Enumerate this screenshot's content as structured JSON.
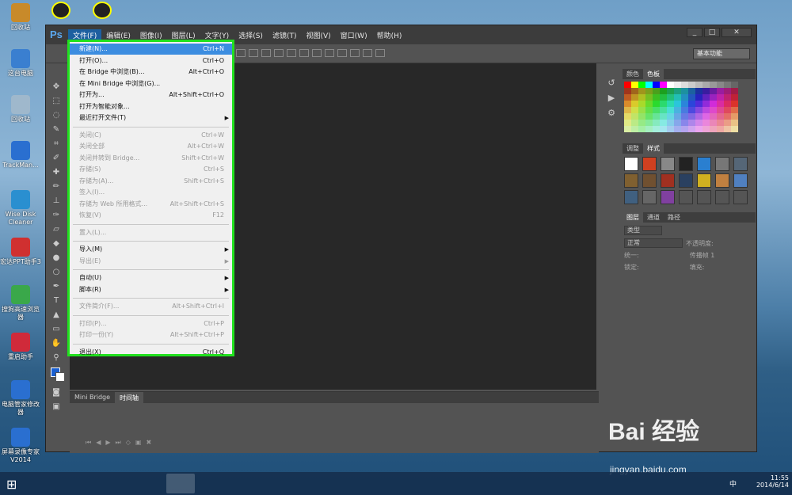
{
  "desktop_icons": [
    {
      "label": "回收站",
      "color": "#c88a2a"
    },
    {
      "label": "这台电脑",
      "color": "#3a7fd0"
    },
    {
      "label": "回收站",
      "color": "#9fb8cc"
    },
    {
      "label": "TrackMan...",
      "color": "#2a6fd0"
    },
    {
      "label": "Wise Disk Cleaner",
      "color": "#2a8fd0"
    },
    {
      "label": "宏达PPT助手3",
      "color": "#d03030"
    },
    {
      "label": "搜狗高速浏览器",
      "color": "#3aa84a"
    },
    {
      "label": "重启助手",
      "color": "#d02a3a"
    },
    {
      "label": "电脑管家修改器",
      "color": "#2a6fd0"
    },
    {
      "label": "屏幕录像专家V2014",
      "color": "#2a6fd0"
    }
  ],
  "top_icons": [
    {
      "label": ""
    },
    {
      "label": ""
    }
  ],
  "ps": {
    "logo": "Ps",
    "menus": [
      "文件(F)",
      "编辑(E)",
      "图像(I)",
      "图层(L)",
      "文字(Y)",
      "选择(S)",
      "滤镜(T)",
      "视图(V)",
      "窗口(W)",
      "帮助(H)"
    ],
    "workspace": "基本功能",
    "window_buttons": [
      "_",
      "□",
      "✕"
    ],
    "bottom_tabs": [
      "Mini Bridge",
      "时间轴"
    ],
    "panel_tabs_1": [
      "颜色",
      "色板"
    ],
    "panel_tabs_2": [
      "调整",
      "样式"
    ],
    "panel_tabs_3": [
      "图层",
      "通道",
      "路径"
    ],
    "layers": {
      "filter": "类型",
      "blend": "正常",
      "opacity_label": "不透明度:",
      "unify_label": "统一:",
      "propagate_label": "传播帧 1",
      "lock_label": "锁定:",
      "fill_label": "填充:"
    }
  },
  "file_menu": [
    {
      "label": "新建(N)...",
      "shortcut": "Ctrl+N",
      "state": "highlight"
    },
    {
      "label": "打开(O)...",
      "shortcut": "Ctrl+O",
      "state": "normal"
    },
    {
      "label": "在 Bridge 中浏览(B)...",
      "shortcut": "Alt+Ctrl+O",
      "state": "normal"
    },
    {
      "label": "在 Mini Bridge 中浏览(G)...",
      "shortcut": "",
      "state": "normal"
    },
    {
      "label": "打开为...",
      "shortcut": "Alt+Shift+Ctrl+O",
      "state": "normal"
    },
    {
      "label": "打开为智能对象...",
      "shortcut": "",
      "state": "normal"
    },
    {
      "label": "最近打开文件(T)",
      "shortcut": "",
      "state": "submenu"
    },
    {
      "sep": true
    },
    {
      "label": "关闭(C)",
      "shortcut": "Ctrl+W",
      "state": "disabled"
    },
    {
      "label": "关闭全部",
      "shortcut": "Alt+Ctrl+W",
      "state": "disabled"
    },
    {
      "label": "关闭并转到 Bridge...",
      "shortcut": "Shift+Ctrl+W",
      "state": "disabled"
    },
    {
      "label": "存储(S)",
      "shortcut": "Ctrl+S",
      "state": "disabled"
    },
    {
      "label": "存储为(A)...",
      "shortcut": "Shift+Ctrl+S",
      "state": "disabled"
    },
    {
      "label": "签入(I)...",
      "shortcut": "",
      "state": "disabled"
    },
    {
      "label": "存储为 Web 所用格式...",
      "shortcut": "Alt+Shift+Ctrl+S",
      "state": "disabled"
    },
    {
      "label": "恢复(V)",
      "shortcut": "F12",
      "state": "disabled"
    },
    {
      "sep": true
    },
    {
      "label": "置入(L)...",
      "shortcut": "",
      "state": "disabled"
    },
    {
      "sep": true
    },
    {
      "label": "导入(M)",
      "shortcut": "",
      "state": "submenu"
    },
    {
      "label": "导出(E)",
      "shortcut": "",
      "state": "submenu-disabled"
    },
    {
      "sep": true
    },
    {
      "label": "自动(U)",
      "shortcut": "",
      "state": "submenu"
    },
    {
      "label": "脚本(R)",
      "shortcut": "",
      "state": "submenu"
    },
    {
      "sep": true
    },
    {
      "label": "文件简介(F)...",
      "shortcut": "Alt+Shift+Ctrl+I",
      "state": "disabled"
    },
    {
      "sep": true
    },
    {
      "label": "打印(P)...",
      "shortcut": "Ctrl+P",
      "state": "disabled"
    },
    {
      "label": "打印一份(Y)",
      "shortcut": "Alt+Shift+Ctrl+P",
      "state": "disabled"
    },
    {
      "sep": true
    },
    {
      "label": "退出(X)",
      "shortcut": "Ctrl+Q",
      "state": "normal"
    }
  ],
  "taskbar": {
    "time": "11:55",
    "date": "2014/6/14",
    "ime": "中"
  },
  "watermark": {
    "brand": "Bai 经验",
    "url": "jingyan.baidu.com"
  }
}
